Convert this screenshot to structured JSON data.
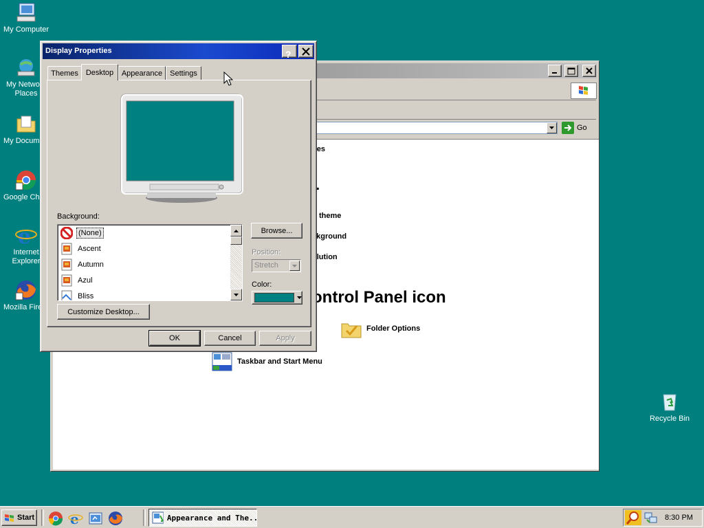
{
  "desktop": {
    "icons": [
      {
        "label": "My Computer"
      },
      {
        "label": "My Network Places"
      },
      {
        "label": "My Documents"
      },
      {
        "label": "Google Chrome"
      },
      {
        "label": "Internet Explorer"
      },
      {
        "label": "Mozilla Firefox"
      },
      {
        "label": "Recycle Bin"
      }
    ],
    "background_color": "#007f7f"
  },
  "control_panel": {
    "address_go": "Go",
    "visible_text": [
      "nes",
      "..",
      "theme",
      "ckground",
      "olution",
      "ontrol Panel icon"
    ],
    "items": [
      {
        "label": "Folder Options"
      },
      {
        "label": "Taskbar and Start Menu"
      }
    ]
  },
  "dialog": {
    "title": "Display Properties",
    "tabs": [
      "Themes",
      "Desktop",
      "Appearance",
      "Settings"
    ],
    "active_tab": "Desktop",
    "background_label": "Background:",
    "backgrounds": [
      "(None)",
      "Ascent",
      "Autumn",
      "Azul",
      "Bliss"
    ],
    "selected_background": "(None)",
    "browse_label": "Browse...",
    "position_label": "Position:",
    "position_value": "Stretch",
    "color_label": "Color:",
    "color_value": "#008080",
    "customize_label": "Customize Desktop...",
    "ok_label": "OK",
    "cancel_label": "Cancel",
    "apply_label": "Apply"
  },
  "taskbar": {
    "start_label": "Start",
    "task_label": "Appearance and The...",
    "clock": "8:30 PM"
  }
}
